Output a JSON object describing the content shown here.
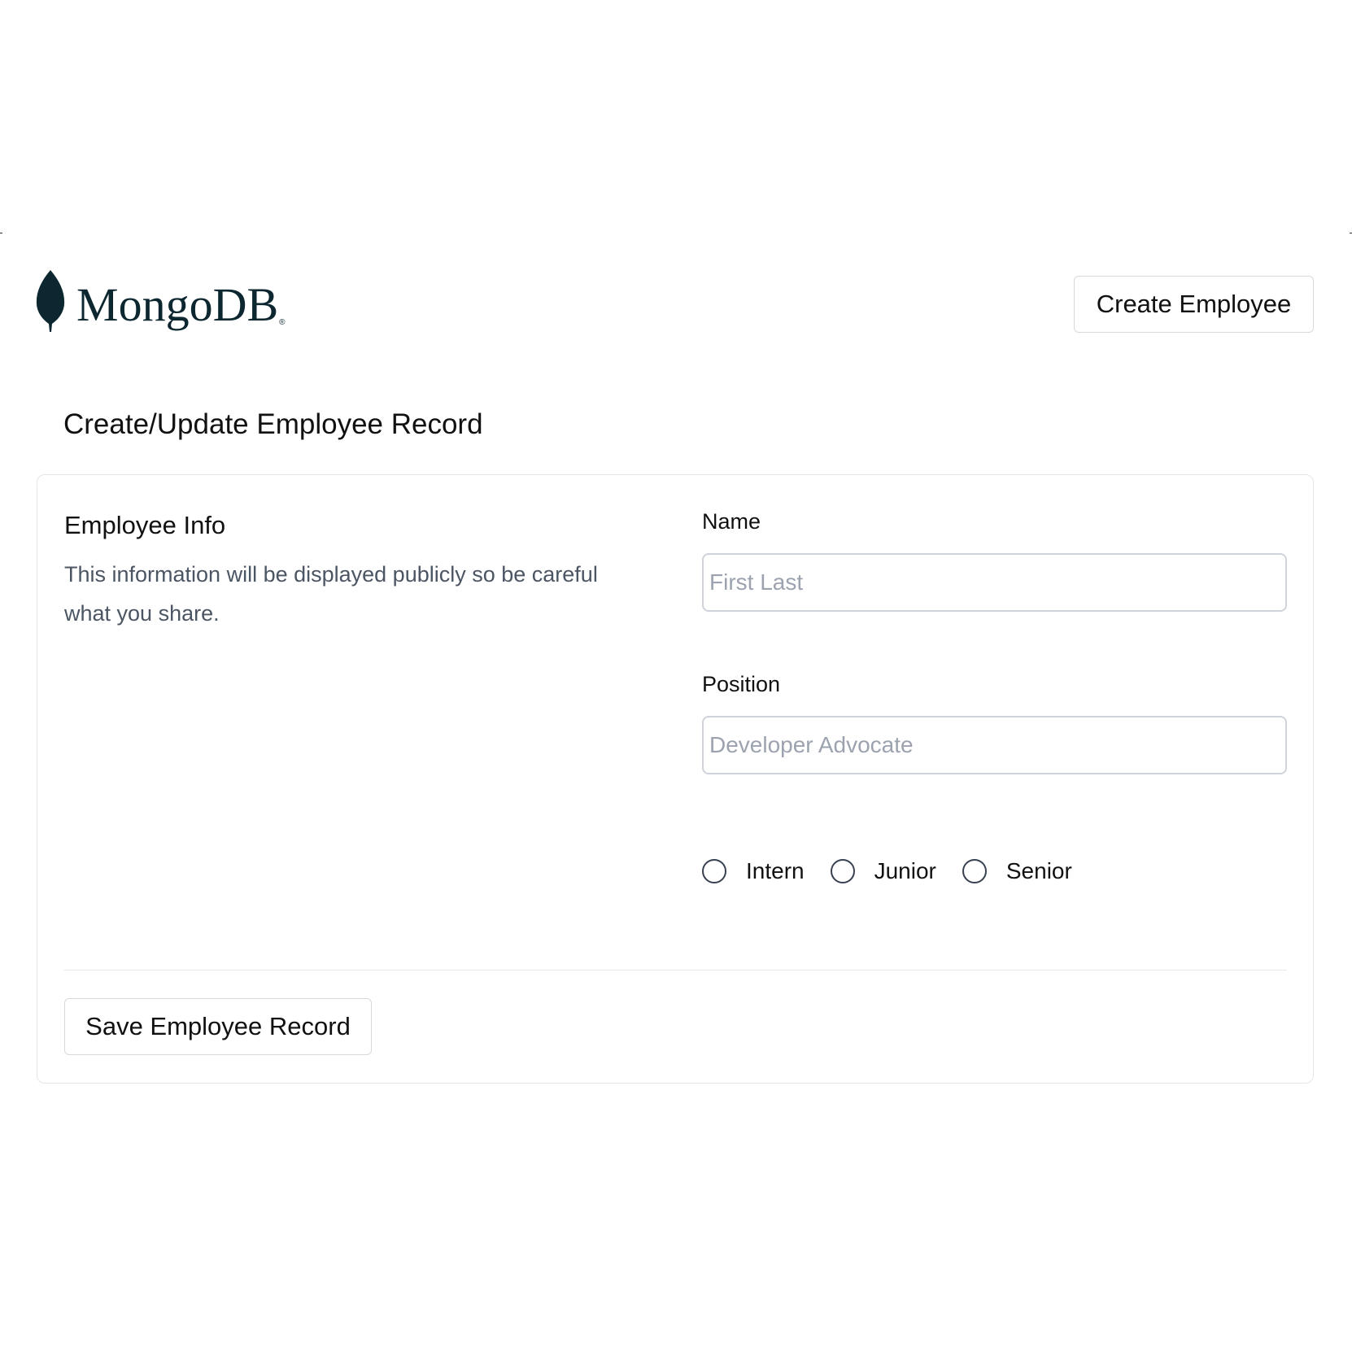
{
  "header": {
    "logo_text": "MongoDB",
    "logo_registered": "®",
    "logo_color": "#0d2730",
    "create_button_label": "Create Employee"
  },
  "form": {
    "heading": "Create/Update Employee Record",
    "section_title": "Employee Info",
    "section_description": "This information will be displayed publicly so be careful what you share.",
    "name": {
      "label": "Name",
      "placeholder": "First Last",
      "value": ""
    },
    "position": {
      "label": "Position",
      "placeholder": "Developer Advocate",
      "value": ""
    },
    "level_options": [
      {
        "label": "Intern",
        "selected": false
      },
      {
        "label": "Junior",
        "selected": false
      },
      {
        "label": "Senior",
        "selected": false
      }
    ],
    "save_button_label": "Save Employee Record"
  }
}
